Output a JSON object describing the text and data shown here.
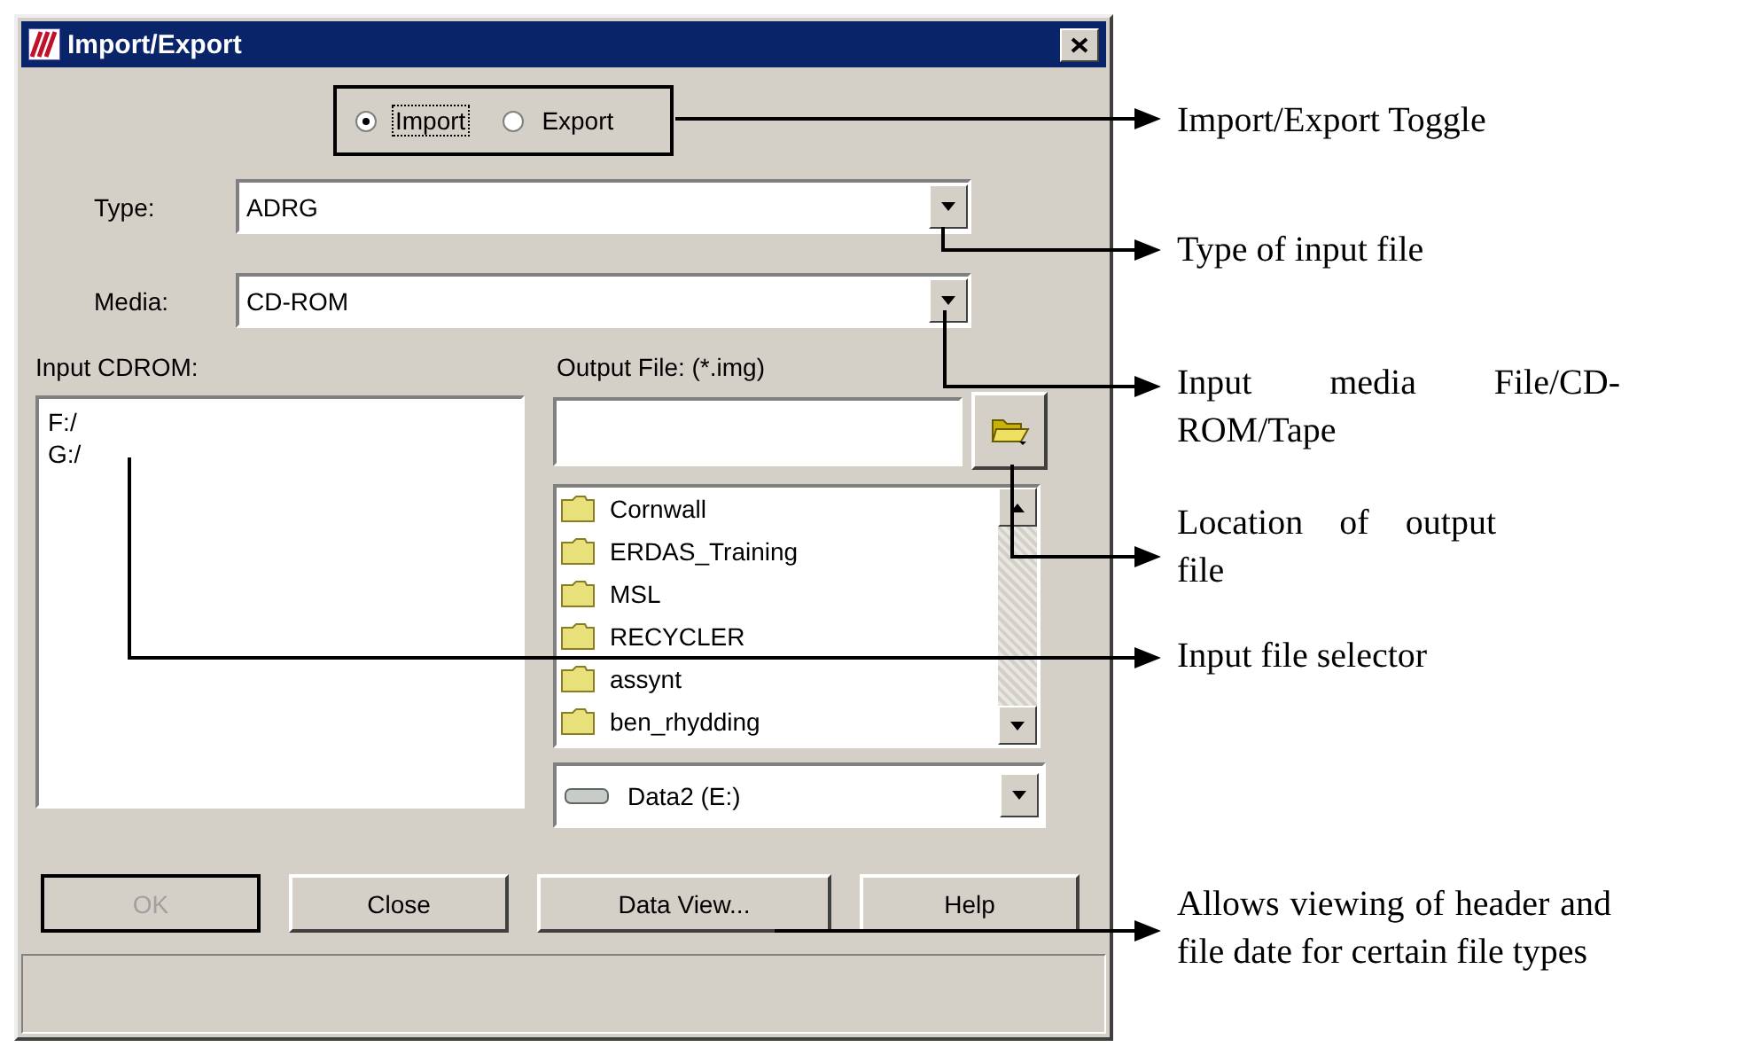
{
  "window": {
    "title": "Import/Export"
  },
  "mode_options": [
    {
      "label": "Import",
      "selected": true
    },
    {
      "label": "Export",
      "selected": false
    }
  ],
  "type": {
    "label": "Type:",
    "value": "ADRG"
  },
  "media": {
    "label": "Media:",
    "value": "CD-ROM"
  },
  "input": {
    "label": "Input CDROM:",
    "items": [
      "F:/",
      "G:/"
    ]
  },
  "output": {
    "label": "Output File: (*.img)",
    "folders": [
      "Cornwall",
      "ERDAS_Training",
      "MSL",
      "RECYCLER",
      "assynt",
      "ben_rhydding"
    ],
    "drive": "Data2 (E:)"
  },
  "buttons": [
    {
      "label": "OK",
      "disabled": true
    },
    {
      "label": "Close",
      "disabled": false
    },
    {
      "label": "Data View...",
      "disabled": false
    },
    {
      "label": "Help",
      "disabled": false
    }
  ],
  "annotations": [
    {
      "text": "Import/Export Toggle"
    },
    {
      "text": "Type of input file"
    },
    {
      "text": "Input media File/CD-ROM/Tape"
    },
    {
      "text": "Location of output file"
    },
    {
      "text": "Input file selector"
    },
    {
      "text": "Allows viewing of header and file date for certain file types"
    }
  ]
}
